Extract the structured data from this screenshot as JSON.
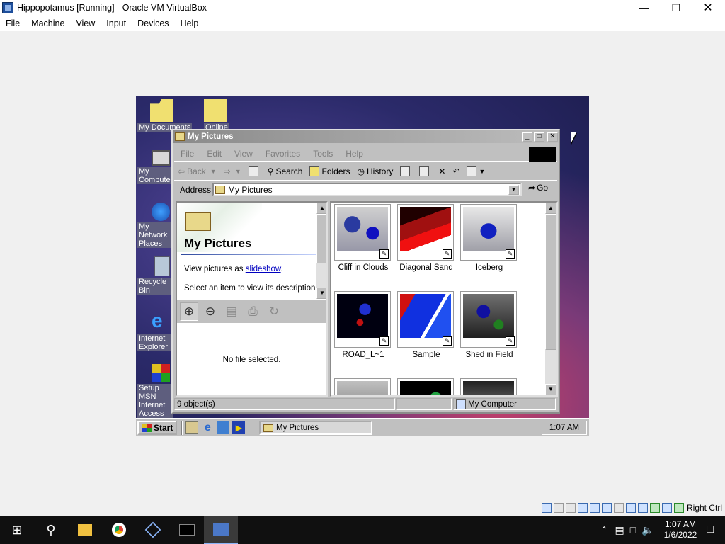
{
  "vbox": {
    "title": "Hippopotamus [Running] - Oracle VM VirtualBox",
    "menu": [
      "File",
      "Machine",
      "View",
      "Input",
      "Devices",
      "Help"
    ],
    "host_key": "Right Ctrl"
  },
  "desktop": {
    "icons": [
      "My Documents",
      "Online",
      "My Computer",
      "My Network Places",
      "Recycle Bin",
      "Internet Explorer",
      "Setup MSN Internet Access"
    ]
  },
  "explorer": {
    "title": "My Pictures",
    "menu": [
      "File",
      "Edit",
      "View",
      "Favorites",
      "Tools",
      "Help"
    ],
    "toolbar": {
      "back": "Back",
      "search": "Search",
      "folders": "Folders",
      "history": "History"
    },
    "address_label": "Address",
    "address_value": "My Pictures",
    "go": "Go",
    "left_pane": {
      "heading": "My Pictures",
      "view_prefix": "View pictures as",
      "slideshow_link": "slideshow",
      "view_suffix": ".",
      "hint": "Select an item to view its description.",
      "no_file": "No file selected."
    },
    "thumbnails": [
      {
        "label": "Cliff in Clouds"
      },
      {
        "label": "Diagonal Sand"
      },
      {
        "label": "Iceberg"
      },
      {
        "label": "ROAD_L~1"
      },
      {
        "label": "Sample"
      },
      {
        "label": "Shed in Field"
      },
      {
        "label": ""
      },
      {
        "label": ""
      },
      {
        "label": ""
      }
    ],
    "status": {
      "count": "9 object(s)",
      "zone": "My Computer"
    }
  },
  "guest_taskbar": {
    "start": "Start",
    "task": "My Pictures",
    "clock": "1:07 AM"
  },
  "host_taskbar": {
    "time": "1:07 AM",
    "date": "1/6/2022"
  }
}
